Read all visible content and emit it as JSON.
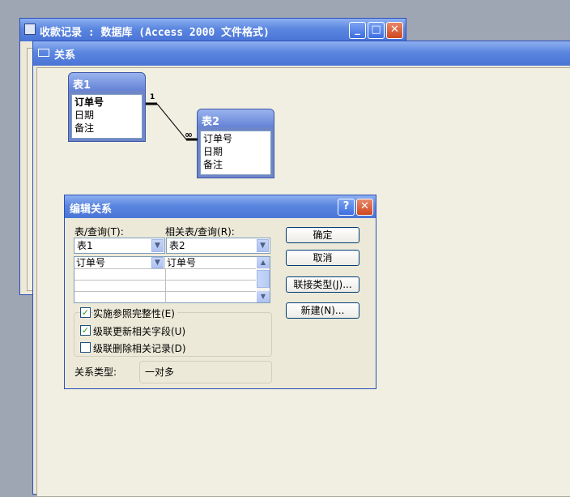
{
  "back_window": {
    "title": "收款记录 : 数据库 (Access 2000 文件格式)"
  },
  "rel_window": {
    "title": "关系"
  },
  "table1": {
    "title": "表1",
    "fields": [
      "订单号",
      "日期",
      "备注"
    ]
  },
  "table2": {
    "title": "表2",
    "fields": [
      "订单号",
      "日期",
      "备注"
    ]
  },
  "relation_line": {
    "one_label": "1",
    "many_label": "∞"
  },
  "dialog": {
    "title": "编辑关系",
    "help": "?",
    "table_label": "表/查询(T):",
    "related_label": "相关表/查询(R):",
    "table_value": "表1",
    "related_value": "表2",
    "grid_rows": [
      [
        "订单号",
        "订单号"
      ],
      [
        "",
        ""
      ],
      [
        "",
        ""
      ],
      [
        "",
        ""
      ]
    ],
    "ok": "确定",
    "cancel": "取消",
    "join_type": "联接类型(J)...",
    "new": "新建(N)...",
    "checkboxes": [
      {
        "label": "实施参照完整性(E)",
        "checked": true
      },
      {
        "label": "级联更新相关字段(U)",
        "checked": true
      },
      {
        "label": "级联删除相关记录(D)",
        "checked": false
      }
    ],
    "rel_type_label": "关系类型:",
    "rel_type_value": "一对多",
    "check_mark": "✓"
  }
}
